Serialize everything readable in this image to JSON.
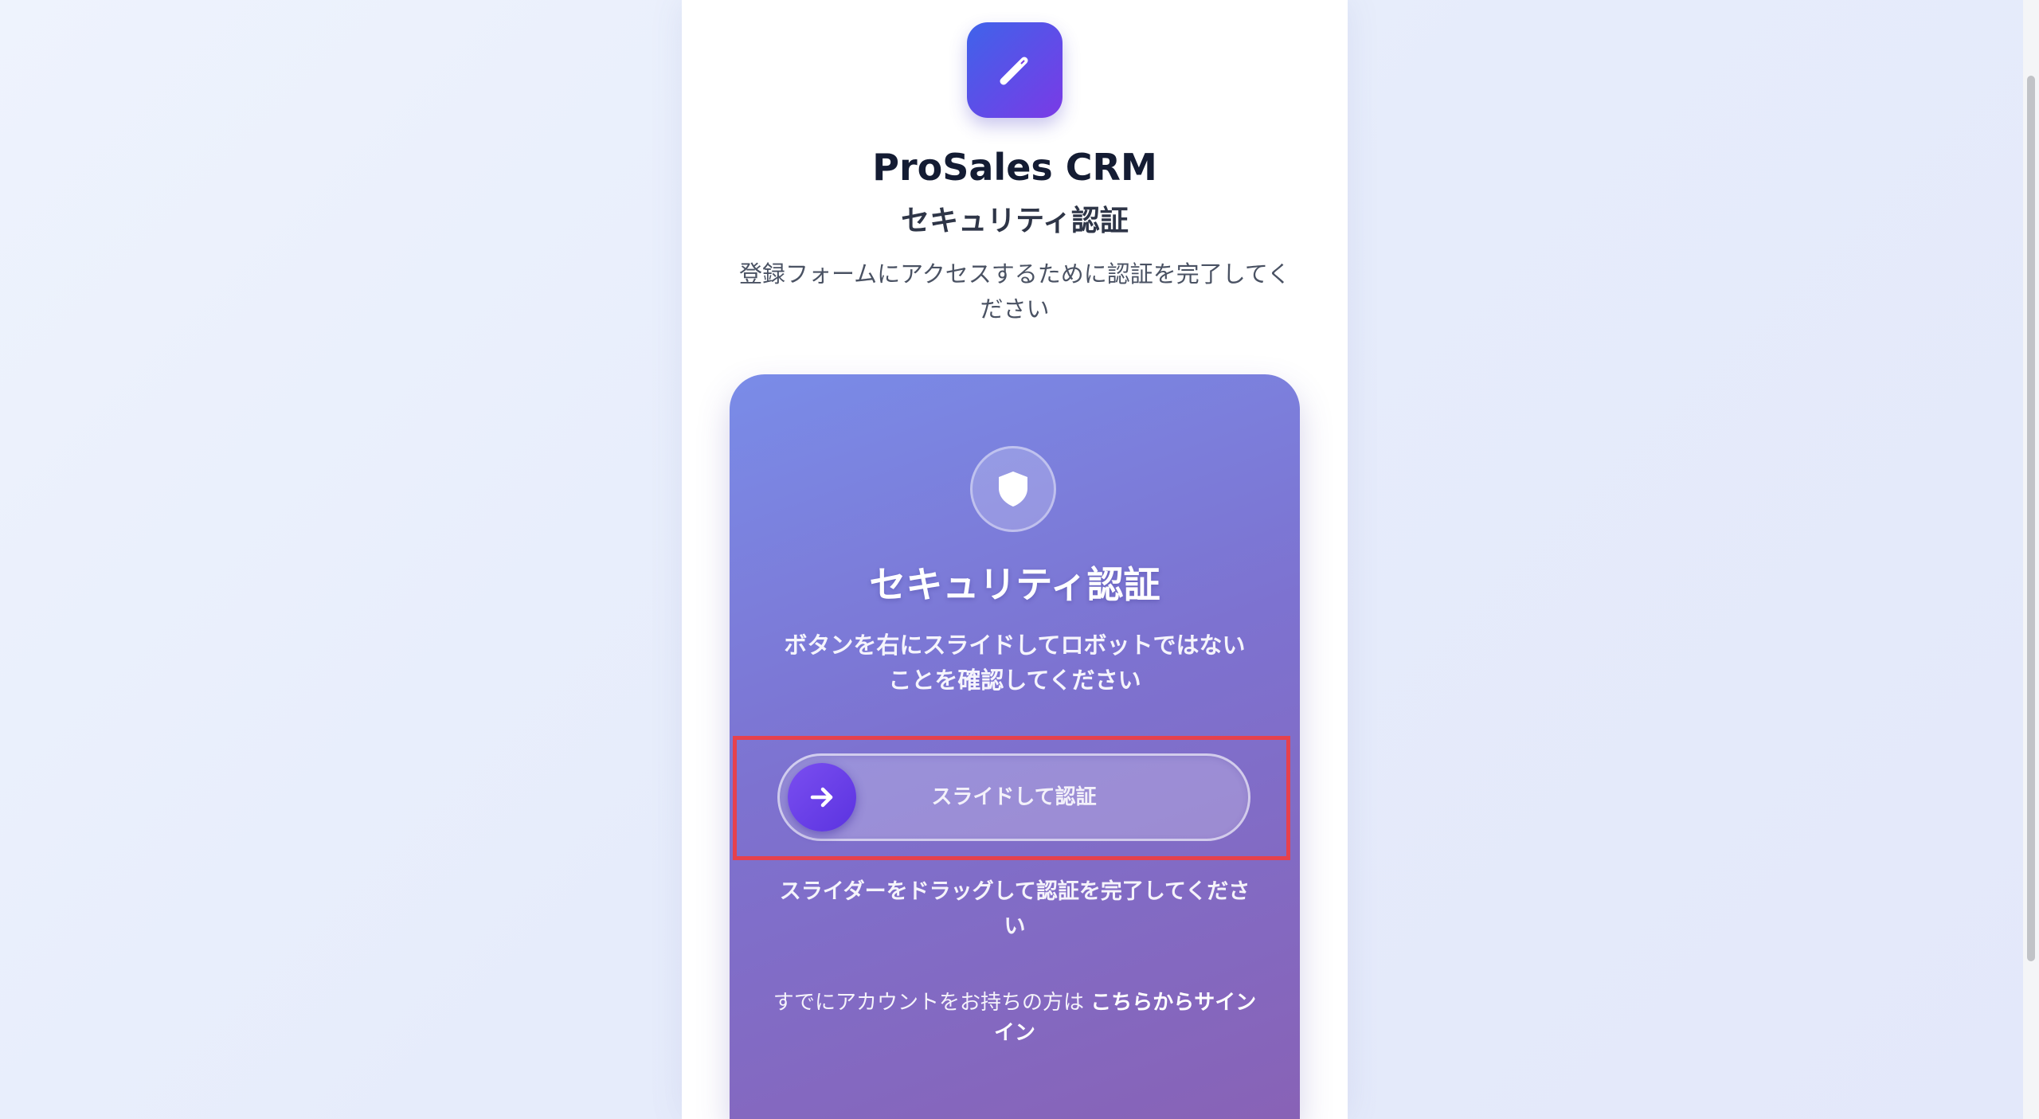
{
  "app": {
    "name": "ProSales CRM",
    "logo_icon": "pencil-icon"
  },
  "page": {
    "heading": "セキュリティ認証",
    "description": "登録フォームにアクセスするために認証を完了してください"
  },
  "verification": {
    "icon": "shield-icon",
    "title": "セキュリティ認証",
    "instruction": "ボタンを右にスライドしてロボットではないことを確認してください",
    "slider_label": "スライドして認証",
    "slider_handle_icon": "arrow-right-icon",
    "slider_progress": 0,
    "hint": "スライダーをドラッグして認証を完了してください",
    "signin_prompt": "すでにアカウントをお持ちの方は",
    "signin_link": "こちらからサインイン"
  },
  "colors": {
    "logo_gradient_start": "#3f63ea",
    "logo_gradient_end": "#7a3ae6",
    "card_gradient_start": "#7a8ce8",
    "card_gradient_end": "#8862b6",
    "slider_handle": "#6a3fe8",
    "highlight_border": "#e6414d"
  }
}
